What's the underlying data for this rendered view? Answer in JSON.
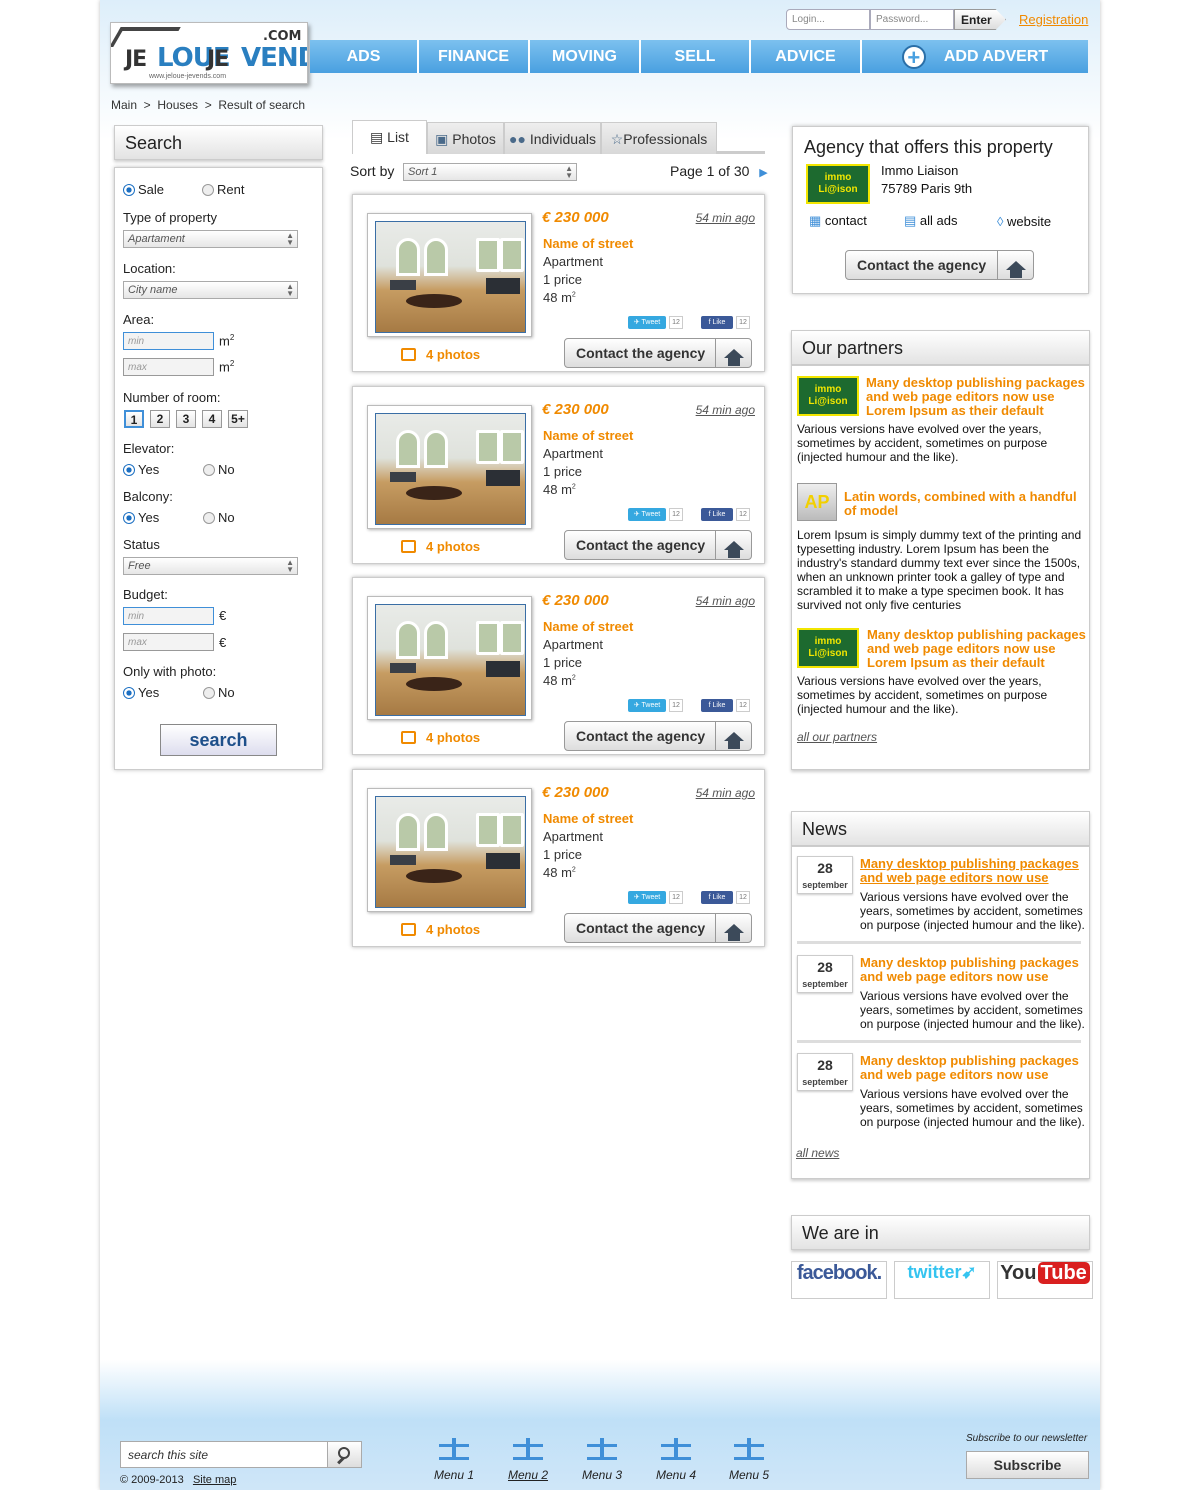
{
  "logo": {
    "part1": "JE",
    "part2": "LOUE",
    "part3": "JE",
    "part4": "VENDS",
    "com": ".COM",
    "url": "www.jeloue-jevends.com"
  },
  "header": {
    "login_placeholder": "Login...",
    "password_placeholder": "Password...",
    "enter_label": "Enter",
    "registration_label": "Registration"
  },
  "nav": {
    "items": [
      "ADS",
      "FINANCE",
      "MOVING",
      "SELL",
      "ADVICE"
    ],
    "add_advert": "ADD ADVERT"
  },
  "breadcrumb": [
    "Main",
    "Houses",
    "Result of search"
  ],
  "search": {
    "title": "Search",
    "deal": {
      "sale": "Sale",
      "rent": "Rent"
    },
    "type_label": "Type of property",
    "type_value": "Apartament",
    "location_label": "Location:",
    "location_value": "City name",
    "area_label": "Area:",
    "area_min": "min",
    "area_max": "max",
    "area_unit": "m",
    "rooms_label": "Number of room:",
    "rooms": [
      "1",
      "2",
      "3",
      "4",
      "5+"
    ],
    "elevator_label": "Elevator:",
    "balcony_label": "Balcony:",
    "photo_label": "Only with photo:",
    "yes": "Yes",
    "no": "No",
    "status_label": "Status",
    "status_value": "Free",
    "budget_label": "Budget:",
    "budget_min": "min",
    "budget_max": "max",
    "currency": "€",
    "button": "search"
  },
  "tabs": [
    "List",
    "Photos",
    "Individuals",
    "Professionals"
  ],
  "sort": {
    "label": "Sort by",
    "value": "Sort 1"
  },
  "pagination": "Page 1 of 30",
  "listing": {
    "price": "€ 230 000",
    "time": "54 min ago",
    "street": "Name of street",
    "type": "Apartment",
    "price_note": "1 price",
    "area": "48 m",
    "area_sup": "2",
    "tweet": "Tweet",
    "like": "Like",
    "count": "12",
    "contact": "Contact the agency",
    "photos": "4 photos"
  },
  "agency": {
    "title": "Agency that offers this property",
    "name": "Immo Liaison",
    "address": "75789 Paris 9th",
    "logo_top": "immo",
    "logo_bottom": "Li@ison",
    "links": [
      "contact",
      "all ads",
      "website"
    ],
    "contact": "Contact the agency"
  },
  "partners": {
    "title": "Our partners",
    "items": [
      {
        "title": "Many desktop publishing packages and web page editors now use Lorem Ipsum as their default",
        "text": "Various versions have evolved over the years, sometimes by accident, sometimes on purpose (injected humour and the like)."
      },
      {
        "title": "Latin words, combined with a handful of model",
        "text": "Lorem Ipsum is simply dummy text of the printing and typesetting industry. Lorem Ipsum has been the industry's standard dummy text ever since the 1500s, when an unknown printer took a galley of type and scrambled it to make a type specimen book. It has survived not only five centuries"
      },
      {
        "title": "Many desktop publishing packages and web page editors now use Lorem Ipsum as their default",
        "text": "Various versions have evolved over the years, sometimes by accident, sometimes on purpose (injected humour and the like)."
      }
    ],
    "all": "all our partners"
  },
  "news": {
    "title": "News",
    "day": "28",
    "month": "september",
    "item_title": "Many desktop publishing packages and web page editors now use",
    "item_text": "Various versions have evolved over the years, sometimes by accident, sometimes on purpose (injected humour and the like).",
    "all": "all news"
  },
  "social": {
    "title": "We are in",
    "facebook": "facebook.",
    "twitter": "twitter",
    "youtube_you": "You",
    "youtube_tube": "Tube"
  },
  "footer": {
    "search_placeholder": "search this site",
    "copyright": "© 2009-2013",
    "sitemap": "Site map",
    "menus": [
      "Menu 1",
      "Menu 2",
      "Menu 3",
      "Menu 4",
      "Menu 5"
    ],
    "newsletter": "Subscribe to our newsletter",
    "subscribe": "Subscribe"
  },
  "colors": {
    "accent_orange": "#f08a00",
    "nav_blue": "#49a0e0",
    "link_blue": "#1d4f8a"
  }
}
